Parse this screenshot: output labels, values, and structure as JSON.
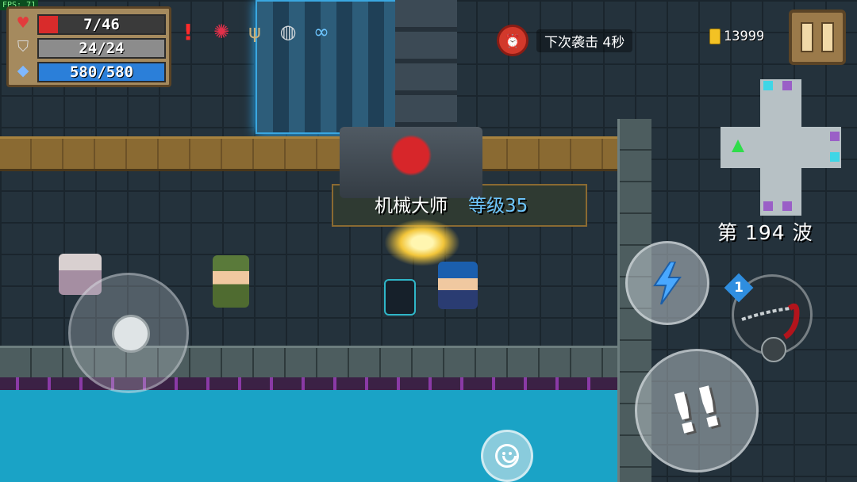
{
  "fps": {
    "label": "FPS: 71"
  },
  "player_stats": {
    "hp": {
      "text": "7/46",
      "value": 7,
      "max": 46,
      "color": "#d92b2b",
      "icon": "heart-icon"
    },
    "armor": {
      "text": "24/24",
      "value": 24,
      "max": 24,
      "color": "#8c8c8c",
      "icon": "shield-icon"
    },
    "energy": {
      "text": "580/580",
      "value": 580,
      "max": 580,
      "color": "#2b7fd9",
      "icon": "diamond-icon"
    }
  },
  "buffs": [
    {
      "name": "alert-icon",
      "glyph": "!"
    },
    {
      "name": "octopus-pet-icon",
      "glyph": "🐙"
    },
    {
      "name": "antler-buff-icon",
      "glyph": "ψ"
    },
    {
      "name": "goggles-buff-icon",
      "glyph": "🥽"
    },
    {
      "name": "infinity-buff-icon",
      "glyph": "∞"
    }
  ],
  "wave_timer": {
    "text": "下次袭击  4秒",
    "icon": "alarm-clock-icon"
  },
  "gold": {
    "amount": "13999",
    "icon": "gold-coin-icon"
  },
  "pause": {
    "icon": "pause-icon"
  },
  "wave": {
    "text": "第 194 波"
  },
  "boss": {
    "name": "机械大师",
    "level": "等级35"
  },
  "controls": {
    "skill": {
      "icon": "lightning-icon"
    },
    "attack": {
      "icon": "attack-burst-icon",
      "glyph": "!!"
    },
    "weapon": {
      "badge": "1",
      "icon": "chain-weapon-icon"
    },
    "emote": {
      "icon": "smiley-icon"
    }
  },
  "colors": {
    "water": "#1aa3c6",
    "accent_blue": "#6ec6ff",
    "alarm_red": "#d2392b"
  }
}
